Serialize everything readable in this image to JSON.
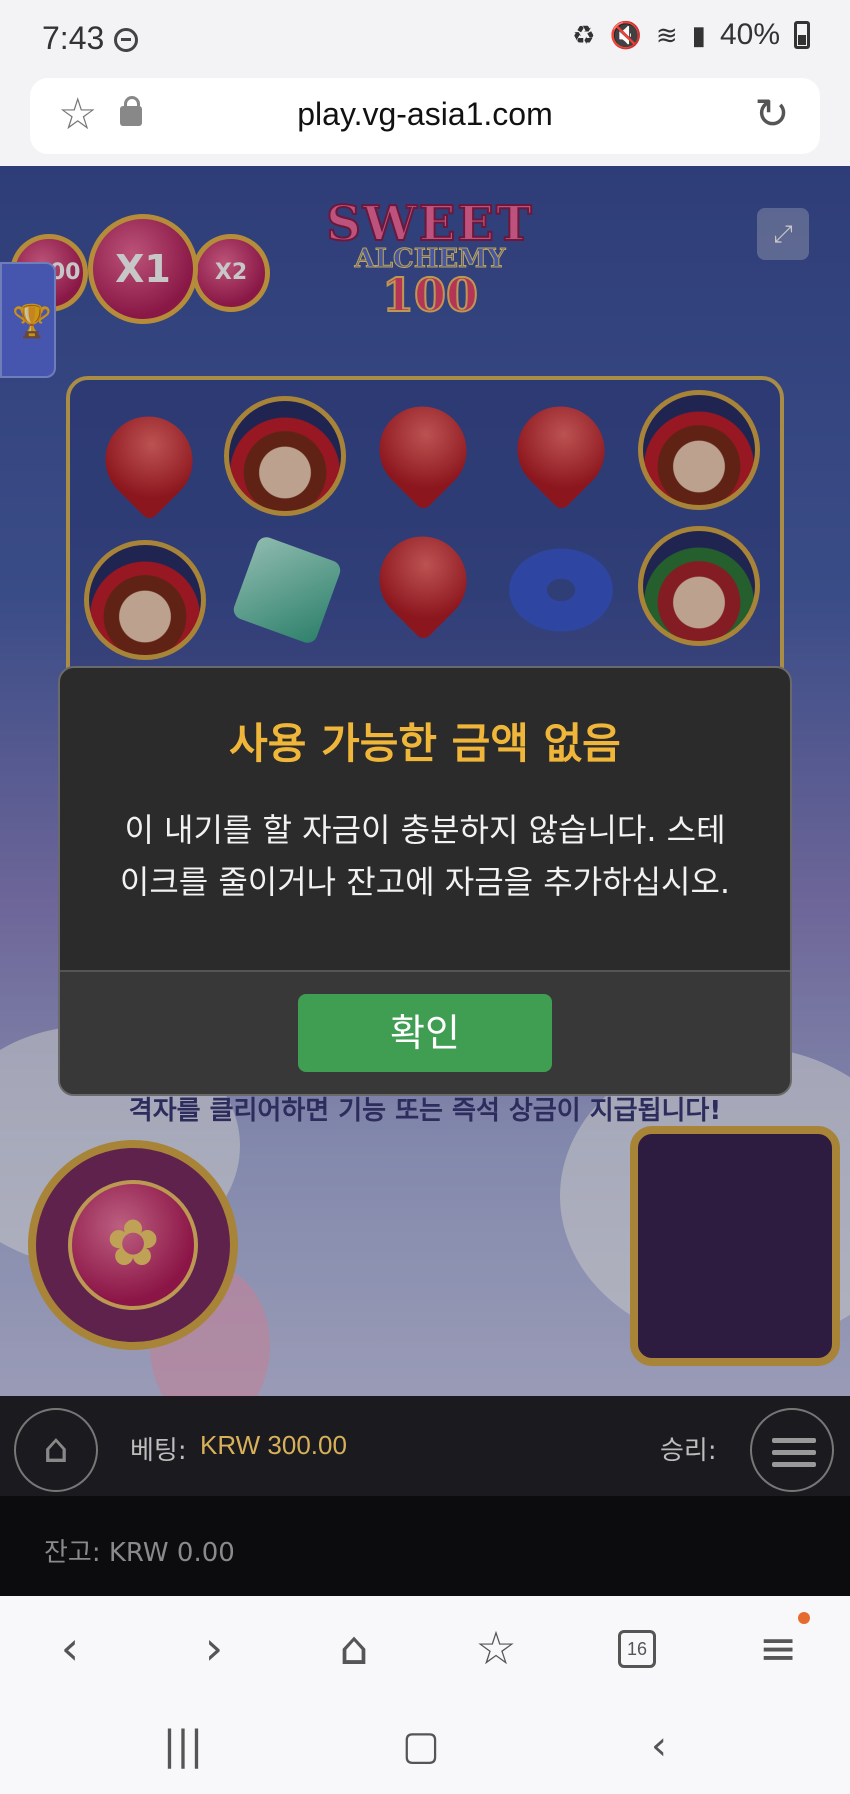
{
  "status_bar": {
    "time": "7:43",
    "battery": "40%"
  },
  "browser": {
    "url": "play.vg-asia1.com",
    "tabs_count": "16"
  },
  "game": {
    "multipliers": [
      "X100",
      "X1",
      "X2"
    ],
    "logo": {
      "line1": "SWEET",
      "line2": "ALCHEMY",
      "line3": "100"
    },
    "info_text": "격자를 클리어하면 기능 또는 즉석 상금이 지급됩니다!",
    "bet_label": "베팅:",
    "bet_value": "KRW 300.00",
    "win_label": "승리:",
    "balance_text": "잔고: KRW 0.00"
  },
  "dialog": {
    "title": "사용 가능한 금액 없음",
    "message_line1": "이 내기를 할 자금이 충분하지 않습니다. 스테",
    "message_line2": "이크를 줄이거나 잔고에 자금을 추가하십시오.",
    "confirm_label": "확인"
  },
  "colors": {
    "dialog_title": "#f0b63a",
    "confirm_button": "#3f9e52",
    "bet_value": "#d8b05a"
  }
}
